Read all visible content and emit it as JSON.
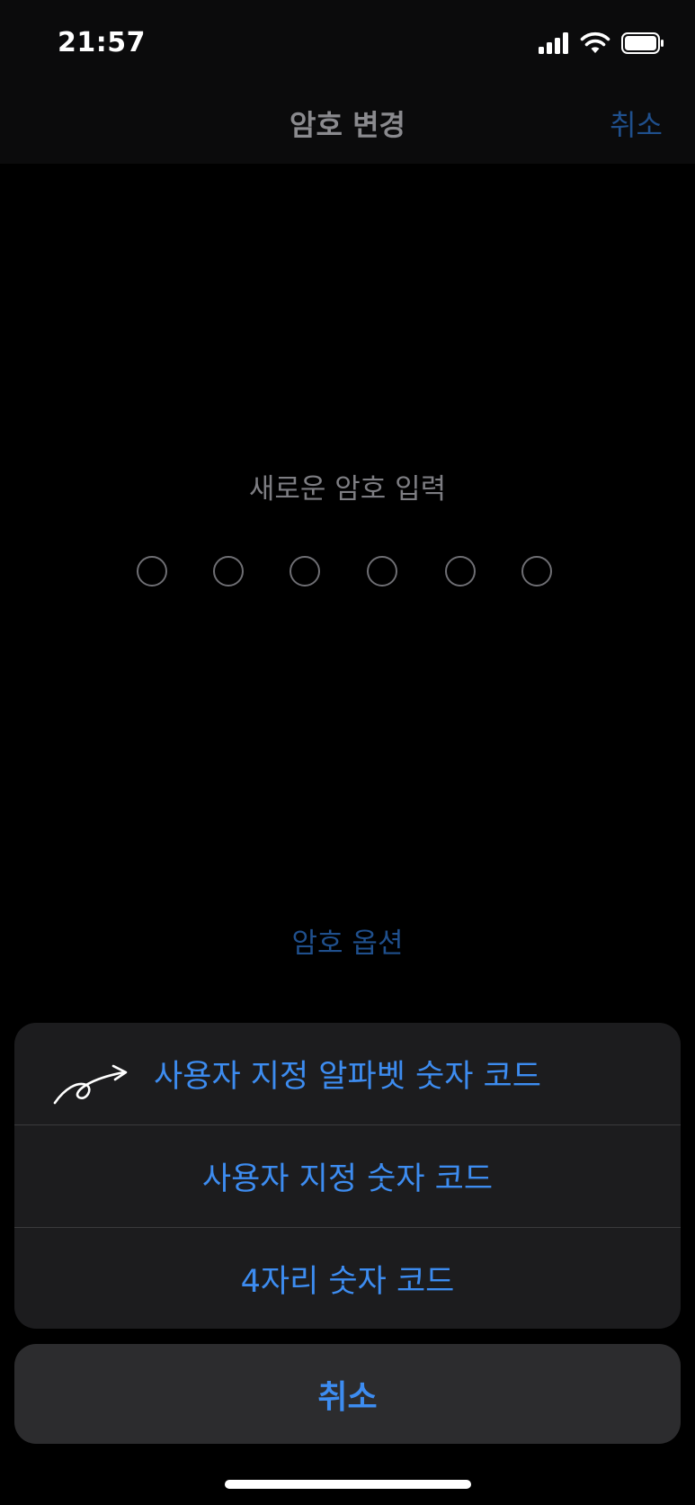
{
  "status_bar": {
    "time": "21:57",
    "icons": [
      "cellular-signal-icon",
      "wifi-icon",
      "battery-icon"
    ]
  },
  "nav": {
    "title": "암호 변경",
    "cancel_label": "취소"
  },
  "passcode": {
    "prompt": "새로운 암호 입력",
    "digit_count": 6,
    "filled_count": 0
  },
  "options_link": "암호 옵션",
  "action_sheet": {
    "items": [
      {
        "label": "사용자 지정 알파벳 숫자 코드"
      },
      {
        "label": "사용자 지정 숫자 코드"
      },
      {
        "label": "4자리 숫자 코드"
      }
    ],
    "cancel_label": "취소"
  },
  "colors": {
    "accent": "#3d8cf0",
    "dim_accent": "#1f4f8c",
    "background": "#000000",
    "sheet_background": "#1c1c1e"
  }
}
